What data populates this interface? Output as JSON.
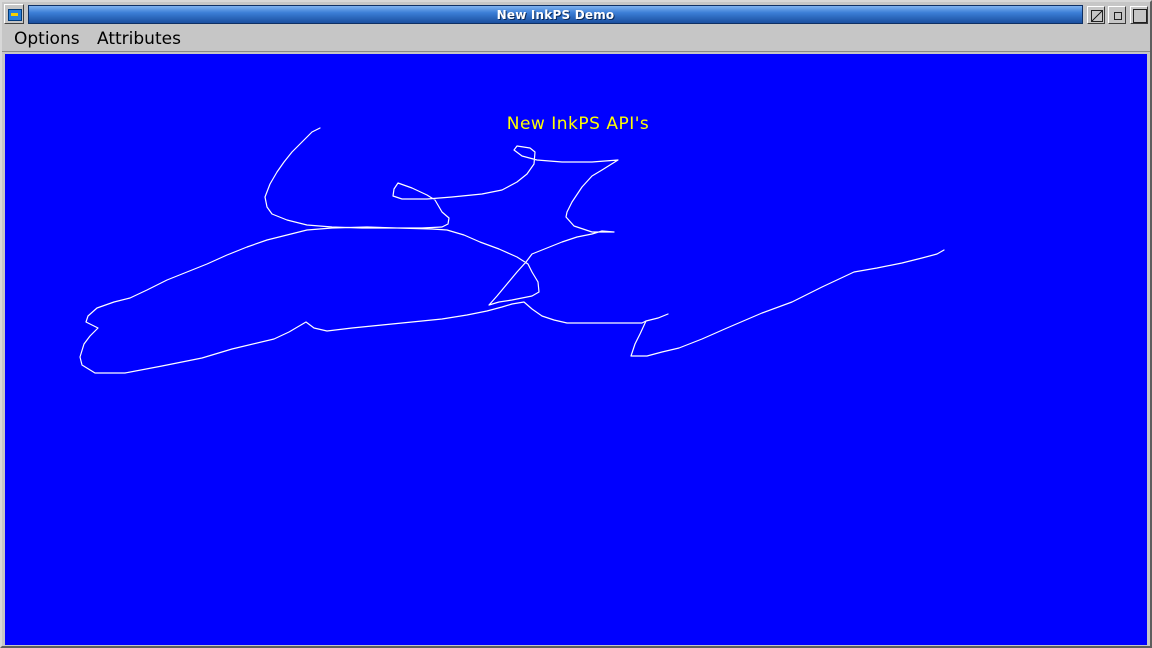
{
  "window": {
    "title": "New InkPS Demo"
  },
  "menubar": {
    "options_label": "Options",
    "attributes_label": "Attributes"
  },
  "canvas": {
    "heading": "New InkPS API's",
    "background_color": "#0000ff",
    "heading_color": "#ffff00",
    "ink_color": "#ffffff"
  },
  "icons": {
    "system_menu": "app-system-menu-icon",
    "hide": "hide-window-icon",
    "minimize": "minimize-icon",
    "maximize": "maximize-icon"
  }
}
